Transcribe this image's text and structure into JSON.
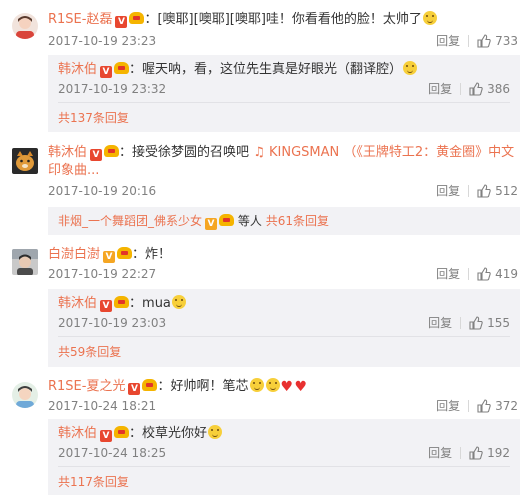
{
  "actions_reply_label": "回复",
  "comments": [
    {
      "username": "R1SE-赵磊",
      "text": "[噢耶][噢耶][噢耶]哇！你看看他的脸！太帅了",
      "time": "2017-10-19 23:23",
      "likes": "733",
      "reply": {
        "username": "韩沐伯",
        "text": "喔天呐，看，这位先生真是好眼光（翻译腔）",
        "time": "2017-10-19 23:32",
        "likes": "386"
      },
      "more": "共137条回复"
    },
    {
      "username": "韩沐伯",
      "text": "接受徐梦圆的召唤吧",
      "link": "KINGSMAN （《王牌特工2：黄金圈》中文印象曲...",
      "time": "2017-10-19 20:16",
      "likes": "512",
      "reply_summary": {
        "user": "非烟_一个舞蹈团_佛系少女",
        "middle": "等人",
        "count": "共61条回复"
      }
    },
    {
      "username": "白澍白澍",
      "text": "炸！",
      "time": "2017-10-19 22:27",
      "likes": "419",
      "reply": {
        "username": "韩沐伯",
        "text": "mua",
        "time": "2017-10-19 23:03",
        "likes": "155"
      },
      "more": "共59条回复"
    },
    {
      "username": "R1SE-夏之光",
      "text": "好帅啊！笔芯",
      "time": "2017-10-24 18:21",
      "likes": "372",
      "reply": {
        "username": "韩沐伯",
        "text": "校草光你好",
        "time": "2017-10-24 18:25",
        "likes": "192"
      },
      "more": "共117条回复"
    }
  ],
  "colors": {
    "name": "#eb7350",
    "meta": "#808080",
    "reply_bg": "#f2f2f5"
  },
  "icons": {
    "verified": "verified-v-icon",
    "vip": "crown-icon",
    "like": "thumb-up-icon"
  }
}
